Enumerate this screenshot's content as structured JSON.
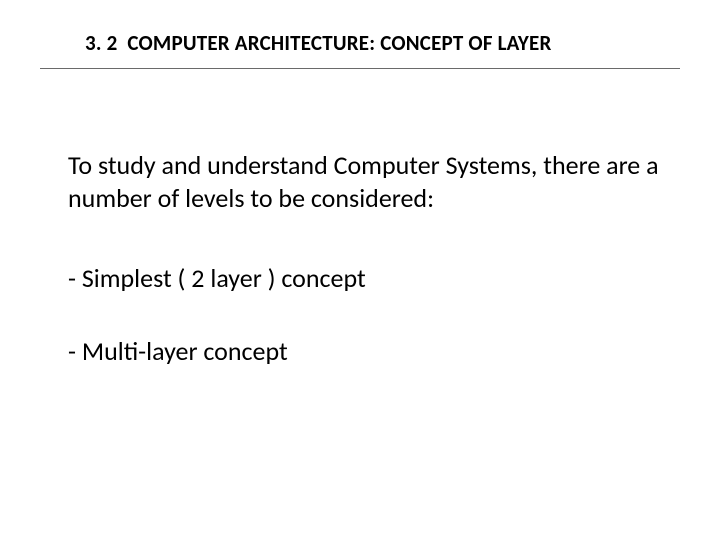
{
  "header": {
    "section_number": "3. 2",
    "title_text": "COMPUTER ARCHITECTURE: CONCEPT OF LAYER"
  },
  "body": {
    "intro": "To study and understand Computer Systems, there are a number of levels to be considered:",
    "items": [
      "- Simplest ( 2 layer ) concept",
      "- Multi-layer concept"
    ]
  }
}
